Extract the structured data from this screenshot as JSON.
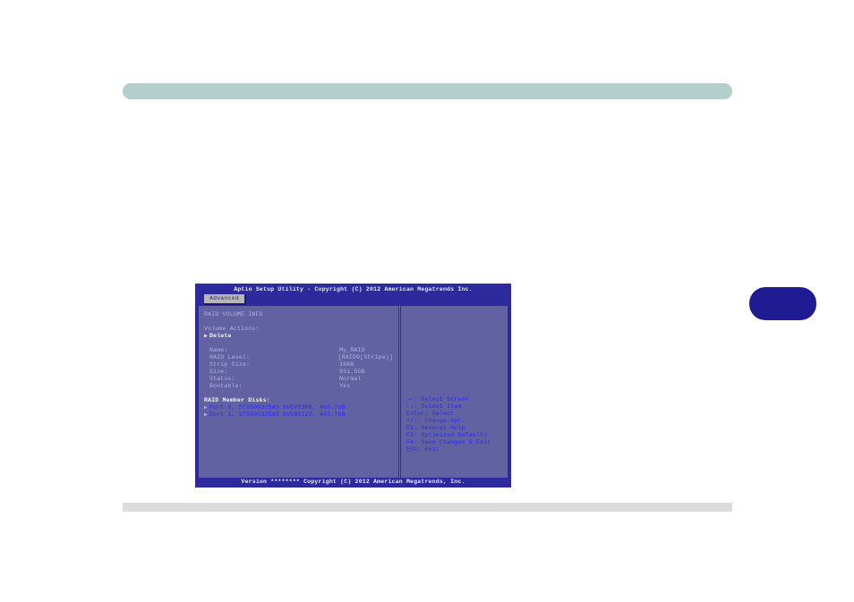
{
  "bios": {
    "title": "Aptio Setup Utility - Copyright (C) 2012 American Megatrends Inc.",
    "tab": "Advanced",
    "section_header": "RAID VOLUME INFO",
    "volume_actions_label": "Volume Actions:",
    "delete_action": "Delete",
    "info": {
      "name_label": "Name:",
      "name_value": "My_RAID",
      "raid_level_label": "RAID Level:",
      "raid_level_value": "[RAID0(Stripe)]",
      "strip_size_label": "Strip Size:",
      "strip_size_value": "16KB",
      "size_label": "Size:",
      "size_value": "931.5GB",
      "status_label": "Status:",
      "status_value": "Normal",
      "bootable_label": "Bootable:",
      "bootable_value": "Yes"
    },
    "member_header": "RAID Member Disks:",
    "members": [
      "Port 0, ST9500325AS 6VEV23P0, 465.7GB",
      "Port 1, ST9500325AS 6VEB8127, 465.7GB"
    ],
    "help": {
      "h1": "→←: Select Screen",
      "h2": "↑↓: Select Item",
      "h3": "Enter: Select",
      "h4": "+/-: Change Opt.",
      "h5": "F1: General Help",
      "h6": "F3: Optimized Defaults",
      "h7": "F4: Save Changes & Exit",
      "h8": "ESC: Exit"
    },
    "footer": "Version ******** Copyright (C) 2012 American Megatrends, Inc."
  }
}
